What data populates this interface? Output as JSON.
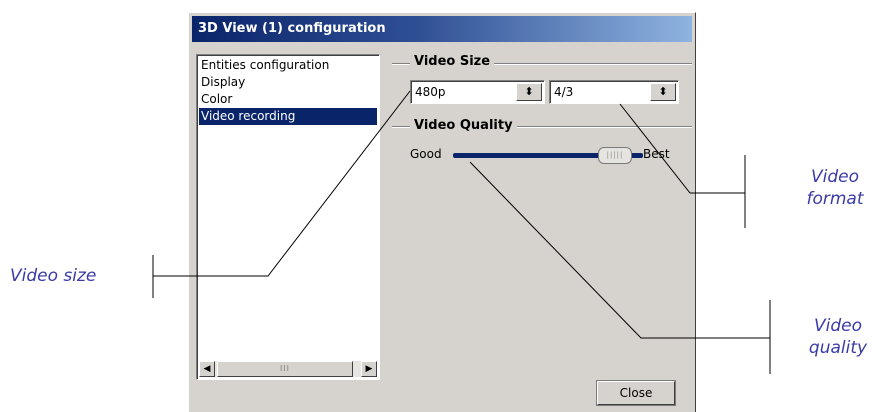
{
  "dialog": {
    "title": "3D View (1) configuration",
    "list_items": [
      {
        "label": "Entities configuration",
        "selected": false
      },
      {
        "label": "Display",
        "selected": false
      },
      {
        "label": "Color",
        "selected": false
      },
      {
        "label": "Video recording",
        "selected": true
      }
    ],
    "scrollbar": {
      "left_arrow": "◀",
      "right_arrow": "▶",
      "thumb_grip": "III"
    },
    "video_size": {
      "title": "Video Size",
      "size_value": "480p",
      "format_value": "4/3",
      "spin_glyph": "⬍"
    },
    "video_quality": {
      "title": "Video Quality",
      "min_label": "Good",
      "max_label": "Best",
      "value_fraction": 0.85
    },
    "close_label": "Close"
  },
  "callouts": {
    "video_size": "Video size",
    "video_format_line1": "Video",
    "video_format_line2": "format",
    "video_quality_line1": "Video",
    "video_quality_line2": "quality"
  },
  "colors": {
    "title_start": "#0a246a",
    "title_end": "#8fb3e0",
    "selection": "#0a246a",
    "callout_text": "#3a3aa8",
    "dialog_face": "#d6d3ce"
  }
}
